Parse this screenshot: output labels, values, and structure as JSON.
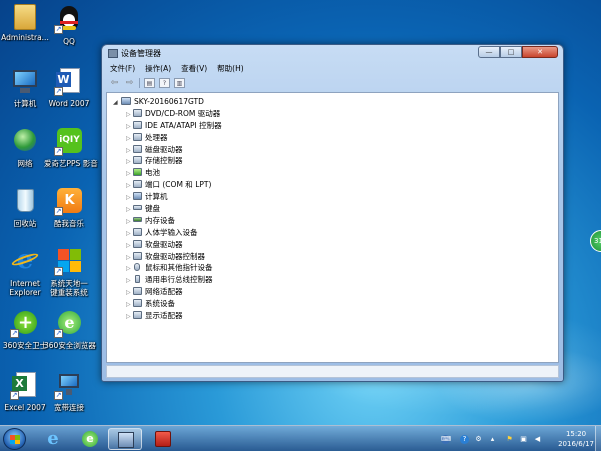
{
  "desktop": {
    "icons": [
      {
        "label": "Administra...",
        "icon": "folder-icon"
      },
      {
        "label": "QQ",
        "icon": "qq-penguin-icon"
      },
      {
        "label": "计算机",
        "icon": "computer-icon"
      },
      {
        "label": "Word 2007",
        "icon": "word-icon"
      },
      {
        "label": "网络",
        "icon": "network-icon"
      },
      {
        "label": "爱奇艺PPS 影音",
        "icon": "iqiyi-icon"
      },
      {
        "label": "回收站",
        "icon": "recycle-bin-icon"
      },
      {
        "label": "酷我音乐",
        "icon": "kuwo-icon"
      },
      {
        "label": "Internet Explorer",
        "icon": "ie-icon"
      },
      {
        "label": "系统天地一键重装系统",
        "icon": "reinstall-icon"
      },
      {
        "label": "360安全卫士",
        "icon": "360-safe-icon"
      },
      {
        "label": "360安全浏览器",
        "icon": "360-browser-icon"
      },
      {
        "label": "Excel 2007",
        "icon": "excel-icon"
      },
      {
        "label": "宽带连接",
        "icon": "broadband-icon"
      }
    ],
    "bubble_text": "31"
  },
  "window": {
    "title": "设备管理器",
    "controls": {
      "minimize": "—",
      "maximize": "□",
      "close": "✕"
    },
    "menu": [
      "文件(F)",
      "操作(A)",
      "查看(V)",
      "帮助(H)"
    ],
    "toolbar_icons": [
      "back-arrow-icon",
      "forward-arrow-icon",
      "properties-icon",
      "help-icon",
      "view-icon"
    ],
    "tree": {
      "root": "SKY-20160617GTD",
      "children": [
        "DVD/CD-ROM 驱动器",
        "IDE ATA/ATAPI 控制器",
        "处理器",
        "磁盘驱动器",
        "存储控制器",
        "电池",
        "端口 (COM 和 LPT)",
        "计算机",
        "键盘",
        "内存设备",
        "人体学输入设备",
        "软盘驱动器",
        "软盘驱动器控制器",
        "鼠标和其他指针设备",
        "通用串行总线控制器",
        "网络适配器",
        "系统设备",
        "显示适配器"
      ]
    }
  },
  "taskbar": {
    "buttons": [
      "ie-icon",
      "360-browser-icon",
      "device-manager-icon",
      "toolbox-icon"
    ],
    "clock": {
      "time": "15:20",
      "date": "2016/6/17"
    }
  }
}
